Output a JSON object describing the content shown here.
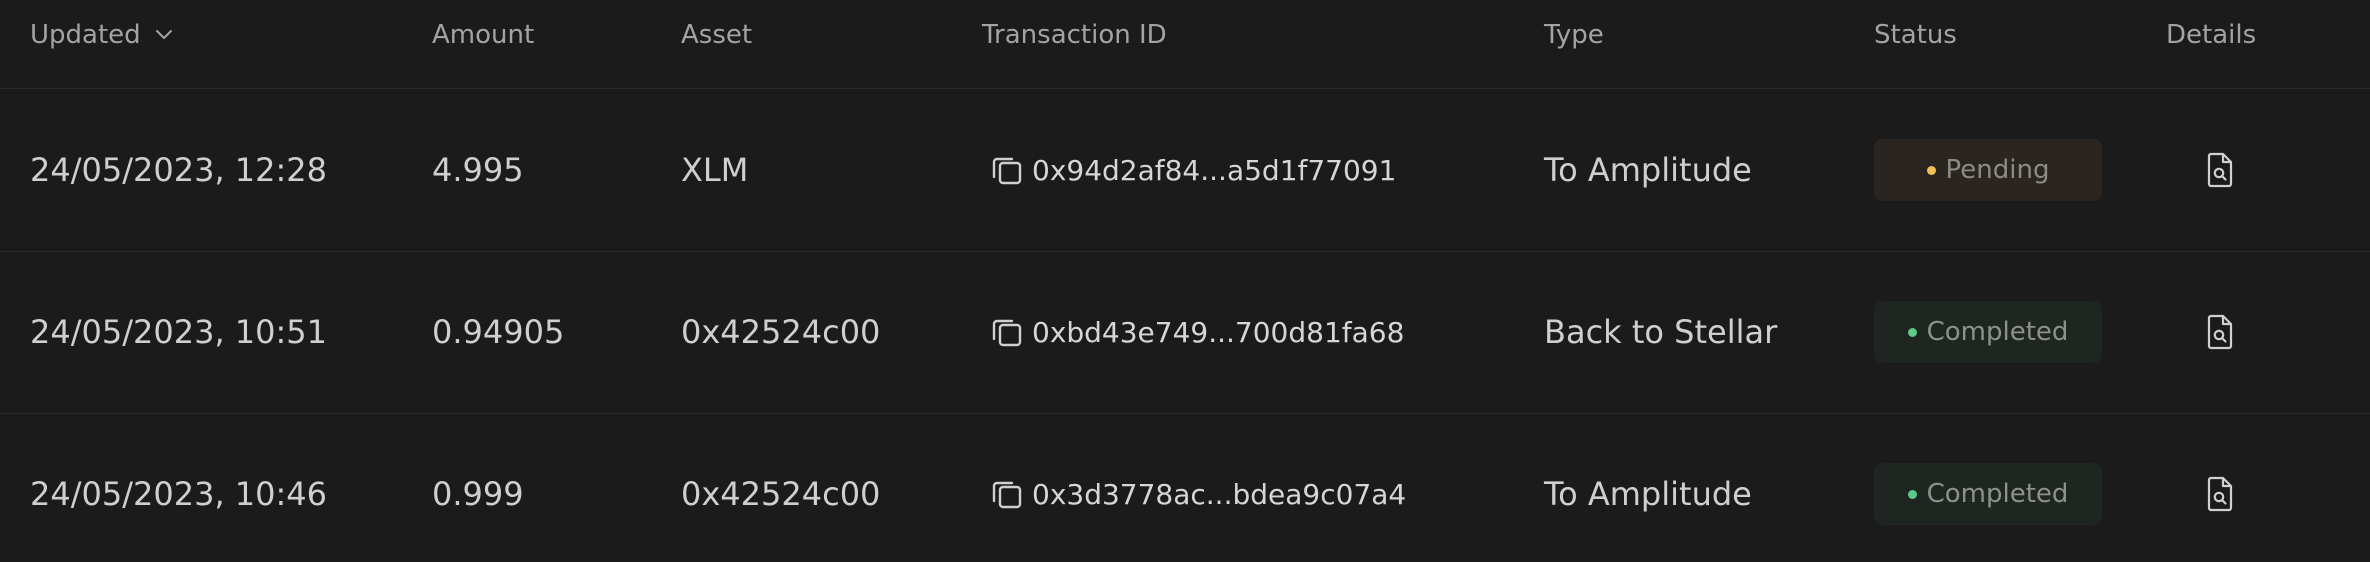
{
  "header": {
    "updated": "Updated",
    "amount": "Amount",
    "asset": "Asset",
    "transaction_id": "Transaction ID",
    "type": "Type",
    "status": "Status",
    "details": "Details"
  },
  "rows": [
    {
      "updated": "24/05/2023, 12:28",
      "amount": "4.995",
      "asset": "XLM",
      "transaction_id": "0x94d2af84...a5d1f77091",
      "type": "To Amplitude",
      "status": "Pending"
    },
    {
      "updated": "24/05/2023, 10:51",
      "amount": "0.94905",
      "asset": "0x42524c00",
      "transaction_id": "0xbd43e749...700d81fa68",
      "type": "Back to Stellar",
      "status": "Completed"
    },
    {
      "updated": "24/05/2023, 10:46",
      "amount": "0.999",
      "asset": "0x42524c00",
      "transaction_id": "0x3d3778ac...bdea9c07a4",
      "type": "To Amplitude",
      "status": "Completed"
    }
  ],
  "icons": {
    "sort": "chevron-down-icon",
    "copy": "copy-icon",
    "details": "document-search-icon"
  },
  "colors": {
    "background": "#1b1b1b",
    "pending_dot": "#f0bf55",
    "completed_dot": "#5ccb8a",
    "pending_badge": "#2a2520",
    "completed_badge": "#1f2622"
  }
}
